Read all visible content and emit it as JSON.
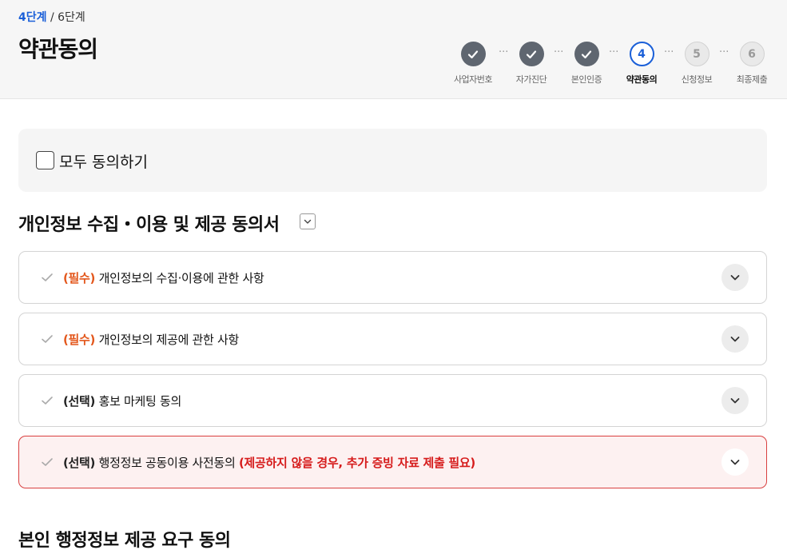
{
  "header": {
    "current_step": "4단계",
    "total_steps": "/ 6단계",
    "title": "약관동의"
  },
  "stepper": [
    {
      "label": "사업자번호",
      "state": "done",
      "number": ""
    },
    {
      "label": "자가진단",
      "state": "done",
      "number": ""
    },
    {
      "label": "본인인증",
      "state": "done",
      "number": ""
    },
    {
      "label": "약관동의",
      "state": "active",
      "number": "4"
    },
    {
      "label": "신청정보",
      "state": "todo",
      "number": "5"
    },
    {
      "label": "최종제출",
      "state": "todo",
      "number": "6"
    }
  ],
  "agree_all": {
    "label": "모두 동의하기",
    "checked": false
  },
  "section1": {
    "title": "개인정보 수집・이용 및 제공 동의서"
  },
  "terms": [
    {
      "tag": "(필수)",
      "text": "개인정보의 수집·이용에 관한 사항",
      "warning": ""
    },
    {
      "tag": "(필수)",
      "text": "개인정보의 제공에 관한 사항",
      "warning": ""
    },
    {
      "tag": "(선택)",
      "text": "홍보 마케팅 동의",
      "warning": ""
    },
    {
      "tag": "(선택)",
      "text": "행정정보 공동이용 사전동의",
      "warning": "(제공하지 않을 경우, 추가 증빙 자료 제출 필요)"
    }
  ],
  "section2": {
    "title": "본인 행정정보 제공 요구 동의"
  },
  "colors": {
    "accent": "#1a5fd8",
    "required": "#e3571c",
    "warning": "#d61c1c",
    "done_step": "#5f6670"
  }
}
